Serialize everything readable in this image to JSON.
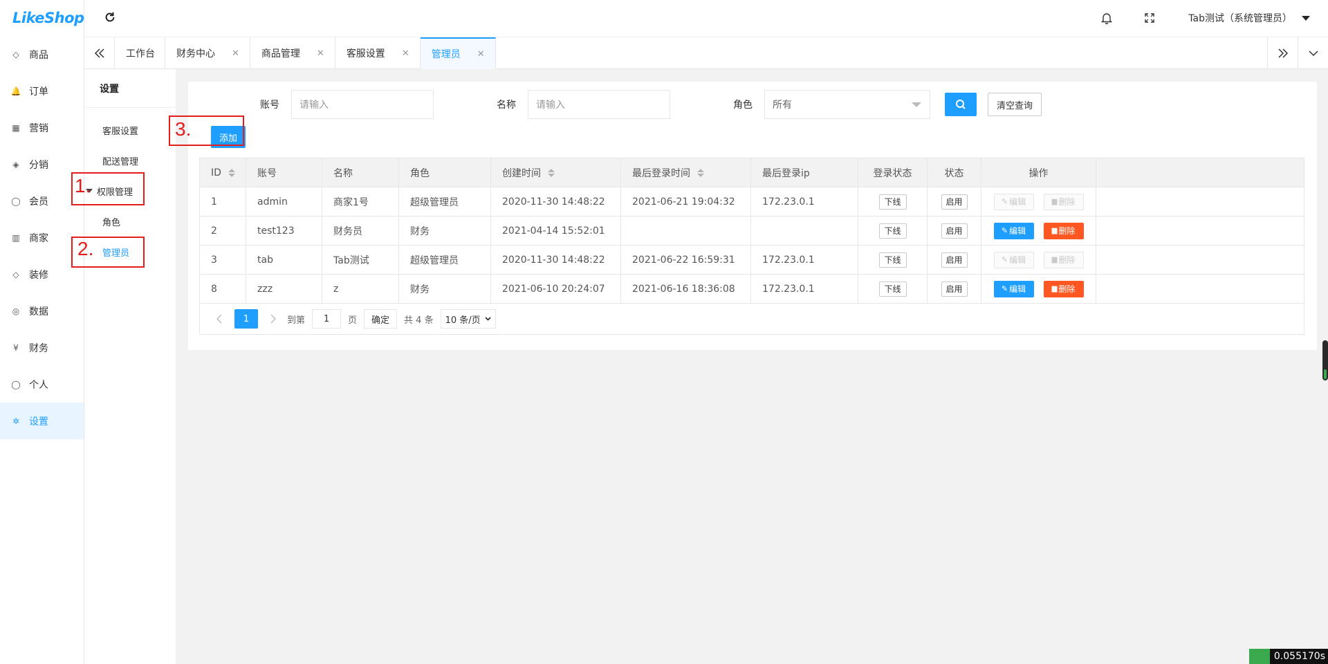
{
  "app": {
    "logo": "LikeShop"
  },
  "sidebar": {
    "items": [
      {
        "label": "商品",
        "icon": "diamond-icon"
      },
      {
        "label": "订单",
        "icon": "bell-icon"
      },
      {
        "label": "营销",
        "icon": "grid-icon"
      },
      {
        "label": "分销",
        "icon": "layers-icon"
      },
      {
        "label": "会员",
        "icon": "user-icon"
      },
      {
        "label": "商家",
        "icon": "store-icon"
      },
      {
        "label": "装修",
        "icon": "tag-icon"
      },
      {
        "label": "数据",
        "icon": "globe-icon"
      },
      {
        "label": "财务",
        "icon": "yen-icon"
      },
      {
        "label": "个人",
        "icon": "person-icon"
      },
      {
        "label": "设置",
        "icon": "gear-icon",
        "active": true
      }
    ]
  },
  "header": {
    "user": "Tab测试（系统管理员）"
  },
  "tabs": [
    {
      "label": "工作台",
      "closable": false
    },
    {
      "label": "财务中心",
      "closable": true
    },
    {
      "label": "商品管理",
      "closable": true
    },
    {
      "label": "客服设置",
      "closable": true
    },
    {
      "label": "管理员",
      "closable": true,
      "active": true
    }
  ],
  "subnav": {
    "title": "设置",
    "items": [
      {
        "label": "客服设置"
      },
      {
        "label": "配送管理"
      },
      {
        "label": "权限管理",
        "group": true
      },
      {
        "label": "角色"
      },
      {
        "label": "管理员",
        "active": true
      }
    ]
  },
  "filter": {
    "account_label": "账号",
    "account_placeholder": "请输入",
    "name_label": "名称",
    "name_placeholder": "请输入",
    "role_label": "角色",
    "role_value": "所有",
    "clear_label": "清空查询"
  },
  "add_label": "添加",
  "annotations": [
    "1.",
    "2.",
    "3."
  ],
  "table": {
    "headers": [
      "ID",
      "账号",
      "名称",
      "角色",
      "创建时间",
      "最后登录时间",
      "最后登录ip",
      "登录状态",
      "状态",
      "操作"
    ],
    "rows": [
      {
        "id": "1",
        "account": "admin",
        "name": "商家1号",
        "role": "超级管理员",
        "created": "2020-11-30 14:48:22",
        "last_login": "2021-06-21 19:04:32",
        "ip": "172.23.0.1",
        "login_status": "下线",
        "status": "启用",
        "editable": false
      },
      {
        "id": "2",
        "account": "test123",
        "name": "财务员",
        "role": "财务",
        "created": "2021-04-14 15:52:01",
        "last_login": "",
        "ip": "",
        "login_status": "下线",
        "status": "启用",
        "editable": true
      },
      {
        "id": "3",
        "account": "tab",
        "name": "Tab测试",
        "role": "超级管理员",
        "created": "2020-11-30 14:48:22",
        "last_login": "2021-06-22 16:59:31",
        "ip": "172.23.0.1",
        "login_status": "下线",
        "status": "启用",
        "editable": false
      },
      {
        "id": "8",
        "account": "zzz",
        "name": "z",
        "role": "财务",
        "created": "2021-06-10 20:24:07",
        "last_login": "2021-06-16 18:36:08",
        "ip": "172.23.0.1",
        "login_status": "下线",
        "status": "启用",
        "editable": true
      }
    ],
    "edit_label": "编辑",
    "delete_label": "删除"
  },
  "pager": {
    "current": "1",
    "goto_label": "到第",
    "goto_value": "1",
    "page_label": "页",
    "ok_label": "确定",
    "total": "共 4 条",
    "size": "10 条/页"
  },
  "timer": "0.055170s",
  "colors": {
    "primary": "#1e9fff",
    "danger": "#ff5722",
    "annotation": "#e51c1c"
  }
}
